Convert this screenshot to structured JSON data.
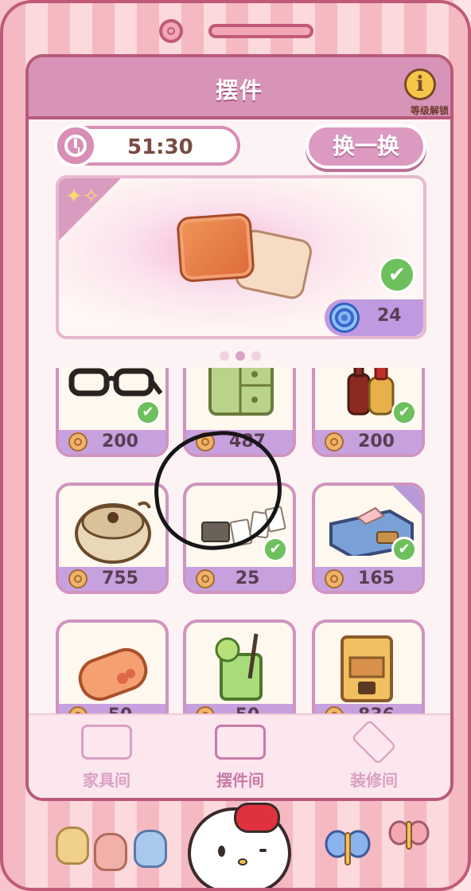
{
  "header": {
    "title": "摆件",
    "info_label": "等级解锁",
    "info_icon": "i"
  },
  "timer": {
    "value": "51:30"
  },
  "refresh": {
    "label": "换一换"
  },
  "featured": {
    "item": "pillow-pair",
    "price": "24",
    "owned": true,
    "currency": "swirl-token"
  },
  "pager": {
    "pages": 3,
    "active": 1
  },
  "grid": {
    "items": [
      {
        "name": "glasses",
        "price": "200",
        "owned": true
      },
      {
        "name": "drawer-cabinet",
        "price": "487",
        "owned": false
      },
      {
        "name": "sauce-bottles",
        "price": "200",
        "owned": true
      },
      {
        "name": "cooking-pot",
        "price": "755",
        "owned": false
      },
      {
        "name": "playing-cards",
        "price": "25",
        "owned": true
      },
      {
        "name": "tissue-box",
        "price": "165",
        "owned": true
      },
      {
        "name": "cushion-roll",
        "price": "50",
        "owned": false
      },
      {
        "name": "lime-drink",
        "price": "50",
        "owned": false
      },
      {
        "name": "coffee-machine",
        "price": "836",
        "owned": false
      }
    ]
  },
  "nav": {
    "items": [
      {
        "label": "家具间",
        "active": false
      },
      {
        "label": "摆件间",
        "active": true
      },
      {
        "label": "装修间",
        "active": false
      }
    ]
  },
  "colors": {
    "accent": "#d894b8",
    "price_bar": "#c7a0de",
    "check": "#6dc05c",
    "border": "#b85a7c"
  }
}
